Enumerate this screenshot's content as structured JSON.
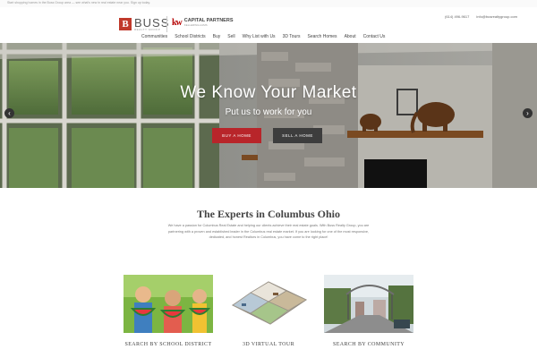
{
  "topbar": {
    "promo_text": "Start shopping homes in the Buss Group area — see what's new in real estate near you. Sign up today."
  },
  "header": {
    "logo_letter": "B",
    "logo_name": "BUSS",
    "logo_sub": "REALTY GROUP",
    "kw_badge": "kw",
    "kw_name": "CAPITAL PARTNERS",
    "kw_sub": "KELLERWILLIAMS",
    "phone": "(614) 496-9617",
    "email": "info@busrealtygroup.com"
  },
  "nav": {
    "items": [
      "Communities",
      "School Districts",
      "Buy",
      "Sell",
      "Why List with Us",
      "3D Tours",
      "Search Homes",
      "About",
      "Contact Us"
    ]
  },
  "hero": {
    "title": "We Know Your Market",
    "subtitle": "Put us to work for you",
    "buy_label": "BUY A HOME",
    "sell_label": "SELL A HOME",
    "prev_icon": "chevron-left-icon",
    "next_icon": "chevron-right-icon"
  },
  "experts": {
    "title": "The Experts in Columbus Ohio",
    "body": "We have a passion for Columbus Real Estate and helping our clients achieve their real estate goals. With Buss Realty Group, you are partnering with a proven and established leader in the Columbus real estate market. If you are looking for one of the most responsive, dedicated, and honest Realtors in Columbus, you have come to the right place!"
  },
  "cards": [
    {
      "label": "SEARCH BY SCHOOL DISTRICT"
    },
    {
      "label": "3D VIRTUAL TOUR"
    },
    {
      "label": "SEARCH BY COMMUNITY"
    }
  ],
  "colors": {
    "accent": "#b8252a",
    "dark_button": "#3d3d3d",
    "kw_red": "#b40101"
  }
}
